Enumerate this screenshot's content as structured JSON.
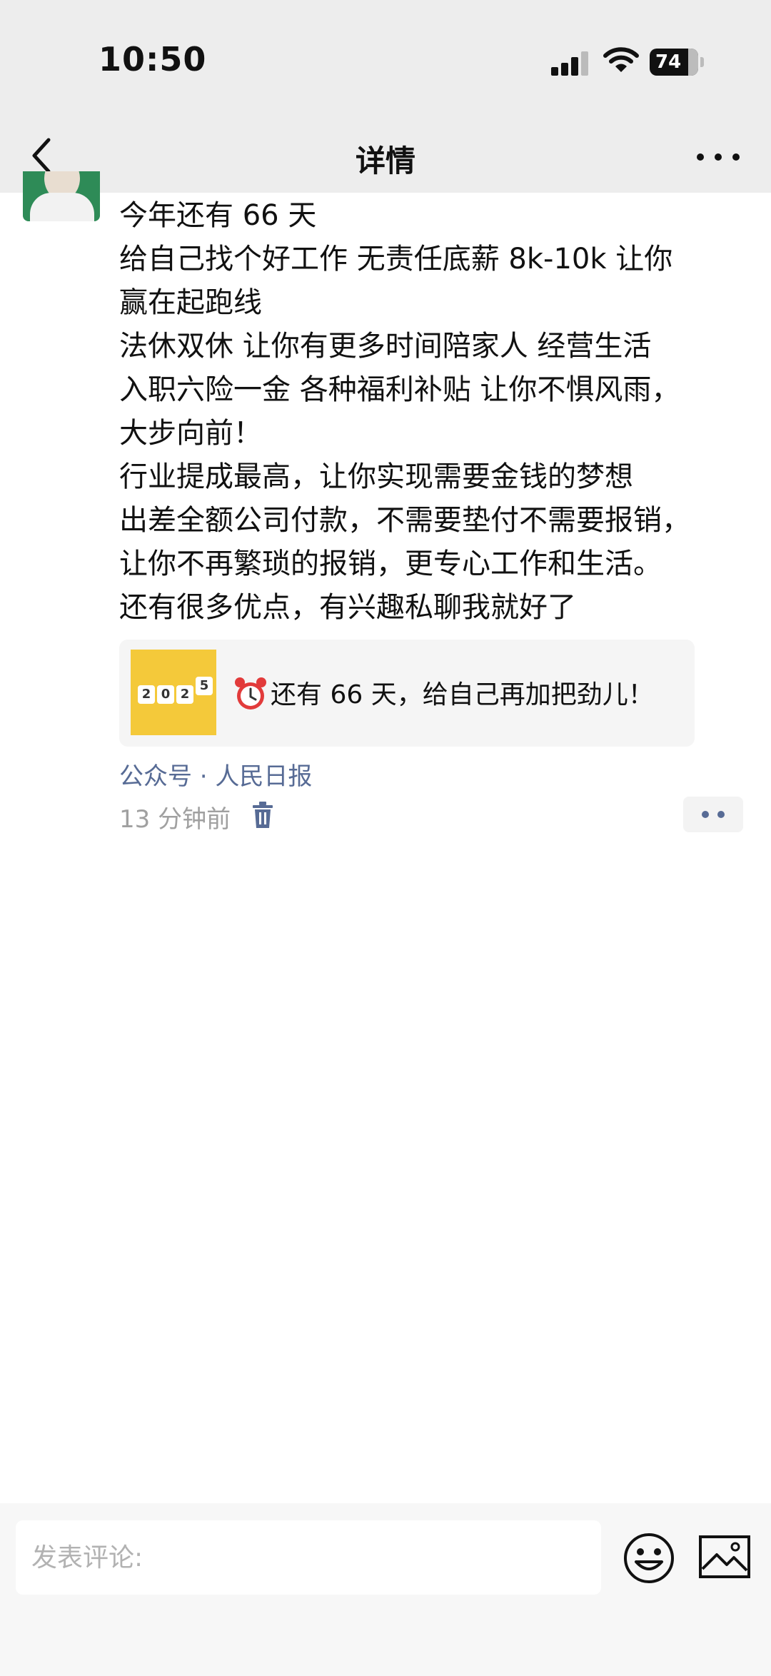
{
  "status_bar": {
    "time": "10:50",
    "battery": "74"
  },
  "nav": {
    "title": "详情"
  },
  "post": {
    "lines": [
      "今年还有 66 天",
      "给自己找个好工作 无责任底薪 8k-10k 让你",
      "赢在起跑线",
      "法休双休 让你有更多时间陪家人 经营生活",
      "入职六险一金 各种福利补贴 让你不惧风雨，",
      "大步向前！",
      "行业提成最高，让你实现需要金钱的梦想",
      "出差全额公司付款，不需要垫付不需要报销，",
      "让你不再繁琐的报销，更专心工作和生活。",
      "还有很多优点，有兴趣私聊我就好了"
    ]
  },
  "share_card": {
    "title": "还有 66 天，给自己再加把劲儿！",
    "thumb_dice": [
      "2",
      "0",
      "2",
      "5"
    ]
  },
  "source": "公众号 · 人民日报",
  "timestamp": "13 分钟前",
  "comment": {
    "placeholder": "发表评论:"
  },
  "colors": {
    "link": "#576b95",
    "nav_bg": "#ededed",
    "thumb_bg": "#f4c93a"
  }
}
